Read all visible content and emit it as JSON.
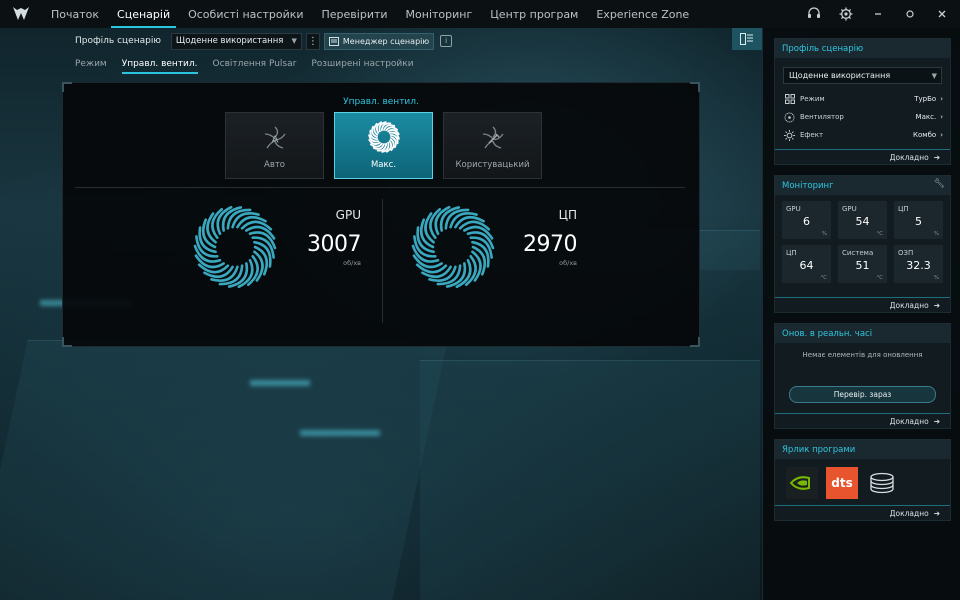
{
  "nav": {
    "items": [
      "Початок",
      "Сценарій",
      "Особисті настройки",
      "Перевірити",
      "Моніторинг",
      "Центр програм",
      "Experience Zone"
    ],
    "active_index": 1
  },
  "profile": {
    "label": "Профіль сценарію",
    "selected": "Щоденне використання",
    "manager_label": "Менеджер сценарію",
    "info_glyph": "i"
  },
  "subtabs": {
    "items": [
      "Режим",
      "Управл. вентил.",
      "Освітлення Pulsar",
      "Розширені настройки"
    ],
    "active_index": 1
  },
  "fan_panel": {
    "title": "Управл. вентил.",
    "modes": [
      {
        "label": "Авто",
        "icon": "auto-fan-icon",
        "active": false
      },
      {
        "label": "Макс.",
        "icon": "max-fan-icon",
        "active": true
      },
      {
        "label": "Користувацький",
        "icon": "custom-fan-icon",
        "active": false
      }
    ],
    "fans": [
      {
        "name": "GPU",
        "rpm": "3007",
        "unit": "об/хв"
      },
      {
        "name": "ЦП",
        "rpm": "2970",
        "unit": "об/хв"
      }
    ]
  },
  "sidebar": {
    "profile_card": {
      "title": "Профіль сценарію",
      "selected": "Щоденне використання",
      "rows": [
        {
          "label": "Режим",
          "value": "ТурБо",
          "icon": "mode-grid-icon"
        },
        {
          "label": "Вентилятор",
          "value": "Макс.",
          "icon": "fan-icon"
        },
        {
          "label": "Ефект",
          "value": "Комбо",
          "icon": "effect-sun-icon"
        }
      ],
      "footer": "Докладно"
    },
    "monitoring_card": {
      "title": "Моніторинг",
      "cells": [
        {
          "label": "GPU",
          "value": "6",
          "unit": "%"
        },
        {
          "label": "GPU",
          "value": "54",
          "unit": "°C"
        },
        {
          "label": "ЦП",
          "value": "5",
          "unit": "%"
        },
        {
          "label": "ЦП",
          "value": "64",
          "unit": "°C"
        },
        {
          "label": "Система",
          "value": "51",
          "unit": "°C"
        },
        {
          "label": "ОЗП",
          "value": "32.3",
          "unit": "%"
        }
      ],
      "footer": "Докладно"
    },
    "updates_card": {
      "title": "Онов. в реальн. часі",
      "empty": "Немає елементів для оновлення",
      "button": "Перевір. зараз",
      "footer": "Докладно"
    },
    "shortcuts_card": {
      "title": "Ярлик програми",
      "apps": [
        {
          "name": "nvidia-icon",
          "color": "#76b900"
        },
        {
          "name": "dts-icon",
          "text": "dts",
          "color": "#e8542e"
        },
        {
          "name": "storage-disk-icon",
          "color": "#d8dde0"
        }
      ],
      "footer": "Докладно"
    }
  },
  "colors": {
    "accent": "#2ac6e0",
    "active_card": "#1b8ba2"
  }
}
